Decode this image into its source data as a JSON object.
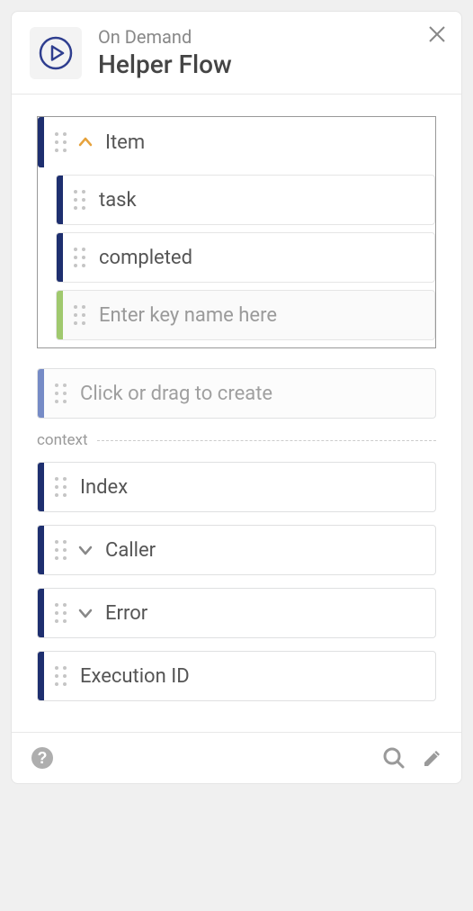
{
  "header": {
    "subtitle": "On Demand",
    "title": "Helper Flow"
  },
  "item_group": {
    "label": "Item",
    "fields": [
      {
        "label": "task"
      },
      {
        "label": "completed"
      }
    ],
    "new_key_placeholder": "Enter key name here"
  },
  "create_placeholder": "Click or drag to create",
  "context": {
    "section_label": "context",
    "fields": [
      {
        "label": "Index",
        "expandable": false
      },
      {
        "label": "Caller",
        "expandable": true
      },
      {
        "label": "Error",
        "expandable": true
      },
      {
        "label": "Execution ID",
        "expandable": false
      }
    ]
  }
}
